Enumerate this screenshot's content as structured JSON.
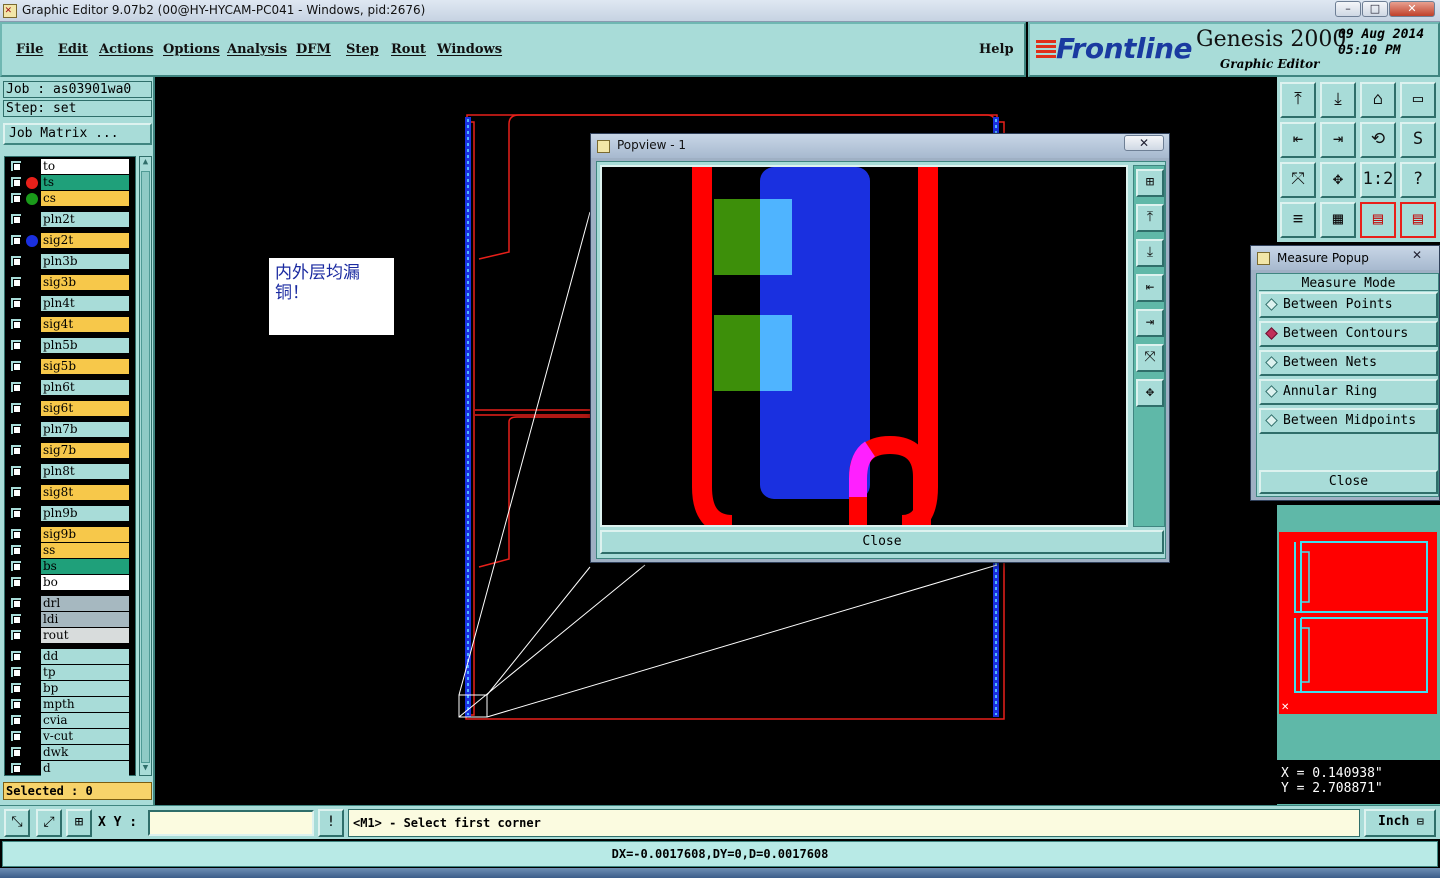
{
  "window": {
    "title": "Graphic Editor 9.07b2 (00@HY-HYCAM-PC041 - Windows, pid:2676)",
    "min": "–",
    "max": "□",
    "close": "✕"
  },
  "menu": {
    "items": [
      "File",
      "Edit",
      "Actions",
      "Options",
      "Analysis",
      "DFM",
      "Step",
      "Rout",
      "Windows"
    ],
    "help": "Help"
  },
  "brand": {
    "logo": "Frontline",
    "product": "Genesis 2000",
    "subtitle": "Graphic Editor",
    "date": "09  Aug 2014",
    "time": "05:10  PM"
  },
  "left": {
    "job": "Job  : as03901wa0",
    "step": "Step: set",
    "job_matrix": "Job Matrix ...",
    "selected": "Selected : 0"
  },
  "layers": [
    {
      "name": "to",
      "color": "#ffffff",
      "dot": ""
    },
    {
      "name": "ts",
      "color": "#1fa07a",
      "dot": "#e8201a"
    },
    {
      "name": "cs",
      "color": "#f7c84a",
      "dot": "#1a9a1a"
    },
    {
      "name": "pln2t",
      "color": "#a8dcd8",
      "dot": ""
    },
    {
      "name": "sig2t",
      "color": "#f7c84a",
      "dot": "#1a30e0"
    },
    {
      "name": "pln3b",
      "color": "#a8dcd8",
      "dot": ""
    },
    {
      "name": "sig3b",
      "color": "#f7c84a",
      "dot": ""
    },
    {
      "name": "pln4t",
      "color": "#a8dcd8",
      "dot": ""
    },
    {
      "name": "sig4t",
      "color": "#f7c84a",
      "dot": ""
    },
    {
      "name": "pln5b",
      "color": "#a8dcd8",
      "dot": ""
    },
    {
      "name": "sig5b",
      "color": "#f7c84a",
      "dot": ""
    },
    {
      "name": "pln6t",
      "color": "#a8dcd8",
      "dot": ""
    },
    {
      "name": "sig6t",
      "color": "#f7c84a",
      "dot": ""
    },
    {
      "name": "pln7b",
      "color": "#a8dcd8",
      "dot": ""
    },
    {
      "name": "sig7b",
      "color": "#f7c84a",
      "dot": ""
    },
    {
      "name": "pln8t",
      "color": "#a8dcd8",
      "dot": ""
    },
    {
      "name": "sig8t",
      "color": "#f7c84a",
      "dot": ""
    },
    {
      "name": "pln9b",
      "color": "#a8dcd8",
      "dot": ""
    },
    {
      "name": "sig9b",
      "color": "#f7c84a",
      "dot": ""
    },
    {
      "name": "ss",
      "color": "#f7c84a",
      "dot": ""
    },
    {
      "name": "bs",
      "color": "#1fa07a",
      "dot": ""
    },
    {
      "name": "bo",
      "color": "#ffffff",
      "dot": ""
    },
    {
      "name": "drl",
      "color": "#a6b8c0",
      "dot": ""
    },
    {
      "name": "ldi",
      "color": "#a6b8c0",
      "dot": ""
    },
    {
      "name": "rout",
      "color": "#d8dcdc",
      "dot": ""
    },
    {
      "name": "dd",
      "color": "#a8dcd8",
      "dot": ""
    },
    {
      "name": "tp",
      "color": "#a8dcd8",
      "dot": ""
    },
    {
      "name": "bp",
      "color": "#a8dcd8",
      "dot": ""
    },
    {
      "name": "mpth",
      "color": "#a8dcd8",
      "dot": ""
    },
    {
      "name": "cvia",
      "color": "#a8dcd8",
      "dot": ""
    },
    {
      "name": "v-cut",
      "color": "#a8dcd8",
      "dot": ""
    },
    {
      "name": "dwk",
      "color": "#a8dcd8",
      "dot": ""
    },
    {
      "name": "d",
      "color": "#a8dcd8",
      "dot": ""
    }
  ],
  "annotation": "内外层均漏铜！",
  "popview": {
    "title": "Popview - 1",
    "close_x": "✕",
    "close": "Close",
    "tools": [
      "⊞",
      "⤒",
      "⤓",
      "⇤",
      "⇥",
      "⤧",
      "✥"
    ]
  },
  "measure": {
    "title": "Measure Popup",
    "close_x": "✕",
    "header": "Measure Mode",
    "options": [
      {
        "label": "Between Points",
        "selected": false
      },
      {
        "label": "Between Contours",
        "selected": true
      },
      {
        "label": "Between Nets",
        "selected": false
      },
      {
        "label": "Annular Ring",
        "selected": false
      },
      {
        "label": "Between Midpoints",
        "selected": false
      }
    ],
    "close": "Close"
  },
  "toolgrid": {
    "buttons": [
      "⤒",
      "⤓",
      "⌂",
      "▭",
      "⇤",
      "⇥",
      "⟲",
      "S",
      "⤧",
      "✥",
      "1:2",
      "?",
      "≡",
      "▦",
      "▤",
      "▤"
    ]
  },
  "coords": {
    "x": "X  = 0.140938\"",
    "y": "Y  = 2.708871\""
  },
  "status": {
    "xy_label": "X Y :",
    "xy_value": "",
    "alert": "!",
    "prompt": "<M1> - Select first corner",
    "unit": "Inch",
    "measure_result": "DX=-0.0017608,DY=0,D=0.0017608"
  },
  "colors": {
    "panel": "#a8dcd8",
    "outline": "#e8201a",
    "copper_blue": "#1a30e0",
    "highlight_blue": "#4fb4ff",
    "pad_green": "#3d8f0a",
    "magenta": "#ff20ff"
  }
}
